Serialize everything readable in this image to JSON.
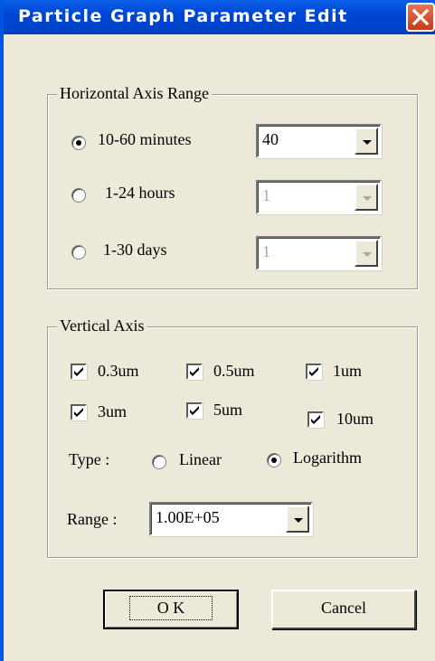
{
  "window": {
    "title": "Particle Graph Parameter Edit"
  },
  "horizontal_axis": {
    "group_title": "Horizontal Axis Range",
    "options": [
      {
        "label": "10-60 minutes",
        "selected": true,
        "combo_value": "40",
        "enabled": true
      },
      {
        "label": "1-24 hours",
        "selected": false,
        "combo_value": "1",
        "enabled": false
      },
      {
        "label": "1-30 days",
        "selected": false,
        "combo_value": "1",
        "enabled": false
      }
    ]
  },
  "vertical_axis": {
    "group_title": "Vertical Axis",
    "sizes": [
      {
        "label": "0.3um",
        "checked": true
      },
      {
        "label": "0.5um",
        "checked": true
      },
      {
        "label": "1um",
        "checked": true
      },
      {
        "label": "3um",
        "checked": true
      },
      {
        "label": "5um",
        "checked": true
      },
      {
        "label": "10um",
        "checked": true
      }
    ],
    "type_label": "Type :",
    "type_options": [
      {
        "label": "Linear",
        "selected": false
      },
      {
        "label": "Logarithm",
        "selected": true
      }
    ],
    "range_label": "Range :",
    "range_value": "1.00E+05"
  },
  "buttons": {
    "ok": "O K",
    "cancel": "Cancel"
  },
  "colors": {
    "titlebar": "#0046D5",
    "close_button": "#D9532C",
    "dialog_face": "#ECE9D8",
    "disabled_text": "#ACA899"
  },
  "icons": {
    "close": "close-icon",
    "dropdown": "chevron-down-icon",
    "check": "checkmark-icon"
  }
}
